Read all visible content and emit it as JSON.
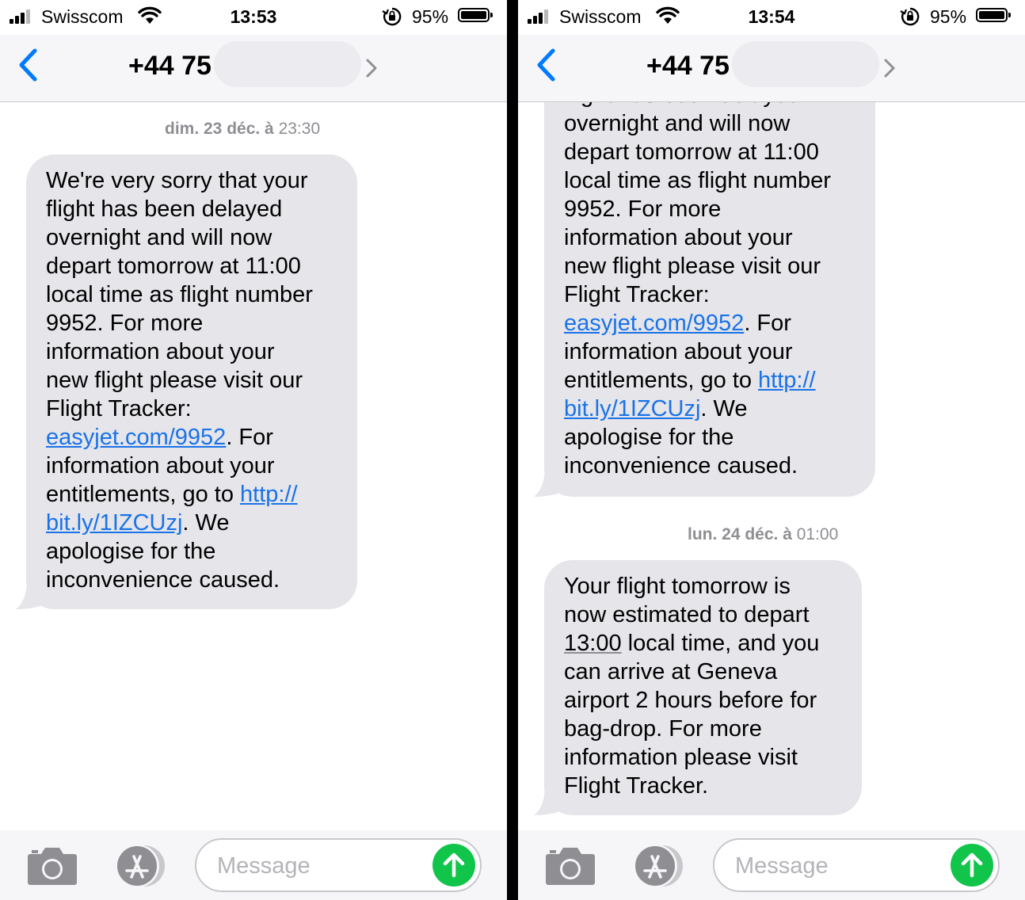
{
  "colors": {
    "bubble_bg": "#e5e5ea",
    "link": "#1a73e8",
    "send_button": "#11c54a",
    "ios_blue": "#007aff",
    "divider": "#000000"
  },
  "icons": [
    "signal-bars-icon",
    "wifi-icon",
    "rotation-lock-icon",
    "battery-icon",
    "back-chevron-icon",
    "details-chevron-icon",
    "camera-icon",
    "app-store-icon",
    "send-arrow-icon"
  ],
  "left": {
    "status": {
      "carrier": "Swisscom",
      "time": "13:53",
      "battery": "95%",
      "battery_level": 0.95
    },
    "nav": {
      "contact": "+44 75"
    },
    "messages": [
      {
        "date_day": "dim. 23 déc. à",
        "date_time": "23:30",
        "lines": [
          "We're very sorry that your",
          "flight has been delayed",
          "overnight and will now",
          "depart tomorrow at 11:00",
          "local time as flight number",
          "9952. For more",
          "information about your",
          "new flight please visit our",
          "Flight Tracker:"
        ],
        "link1": "easyjet.com/9952",
        "after_link1": ". For",
        "line_a": "information about your",
        "line_b_pre": "entitlements, go to ",
        "link2a": "http://",
        "link2b": "bit.ly/1IZCUzj",
        "after_link2": ". We",
        "end_lines": [
          "apologise for the",
          "inconvenience caused."
        ]
      }
    ],
    "input": {
      "placeholder": "Message"
    }
  },
  "right": {
    "status": {
      "carrier": "Swisscom",
      "time": "13:54",
      "battery": "95%",
      "battery_level": 0.95
    },
    "nav": {
      "contact": "+44 75"
    },
    "messages": [
      {
        "lines": [
          "flight has been delayed",
          "overnight and will now",
          "depart tomorrow at 11:00",
          "local time as flight number",
          "9952. For more",
          "information about your",
          "new flight please visit our",
          "Flight Tracker:"
        ],
        "link1": "easyjet.com/9952",
        "after_link1": ". For",
        "line_a": "information about your",
        "line_b_pre": "entitlements, go to ",
        "link2a": "http://",
        "link2b": "bit.ly/1IZCUzj",
        "after_link2": ". We",
        "end_lines": [
          "apologise for the",
          "inconvenience caused."
        ]
      },
      {
        "date_day": "lun. 24 déc. à",
        "date_time": "01:00",
        "line1": "Your flight tomorrow is",
        "line2": "now estimated to depart",
        "time_link": "13:00",
        "line3_rest": " local time, and you",
        "line4": "can arrive at Geneva",
        "line5": "airport 2 hours before for",
        "line6": "bag-drop. For more",
        "line7": "information please visit",
        "line8": "Flight Tracker."
      }
    ],
    "input": {
      "placeholder": "Message"
    }
  }
}
